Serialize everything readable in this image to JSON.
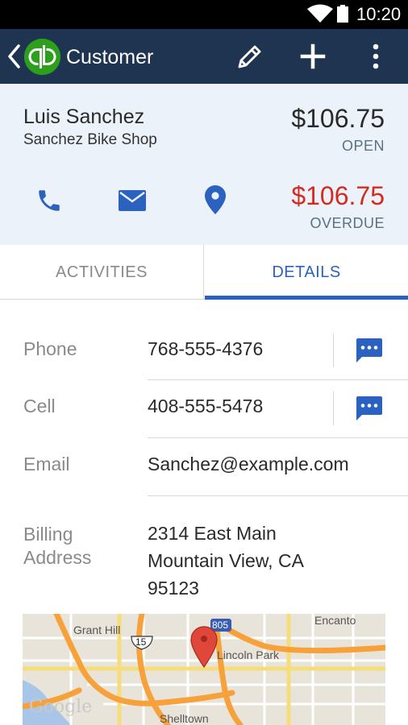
{
  "status_bar": {
    "time": "10:20"
  },
  "app_bar": {
    "title": "Customer",
    "logo_text": "qb"
  },
  "customer": {
    "name": "Luis Sanchez",
    "company": "Sanchez Bike Shop",
    "balance": "$106.75",
    "balance_status": "OPEN",
    "overdue_amount": "$106.75",
    "overdue_status": "OVERDUE"
  },
  "tabs": [
    {
      "label": "ACTIVITIES",
      "selected": false
    },
    {
      "label": "DETAILS",
      "selected": true
    }
  ],
  "details": {
    "phone": {
      "label": "Phone",
      "value": "768-555-4376"
    },
    "cell": {
      "label": "Cell",
      "value": "408-555-5478"
    },
    "email": {
      "label": "Email",
      "value": "Sanchez@example.com"
    },
    "billing": {
      "label_line1": "Billing",
      "label_line2": "Address",
      "line1": "2314 East Main",
      "line2": "Mountain View,  CA",
      "line3": "95123"
    }
  },
  "map": {
    "labels": {
      "grant_hill": "Grant Hill",
      "encanto": "Encanto",
      "lincoln_park": "Lincoln Park",
      "shelltown": "Shelltown",
      "route_15": "15",
      "route_805": "805"
    },
    "attribution": "Google"
  },
  "colors": {
    "app_bar": "#1f3451",
    "brand_green": "#2ca01c",
    "accent_blue": "#2b62c0",
    "overdue_red": "#d52b1e",
    "summary_bg": "#ecf2fa"
  }
}
